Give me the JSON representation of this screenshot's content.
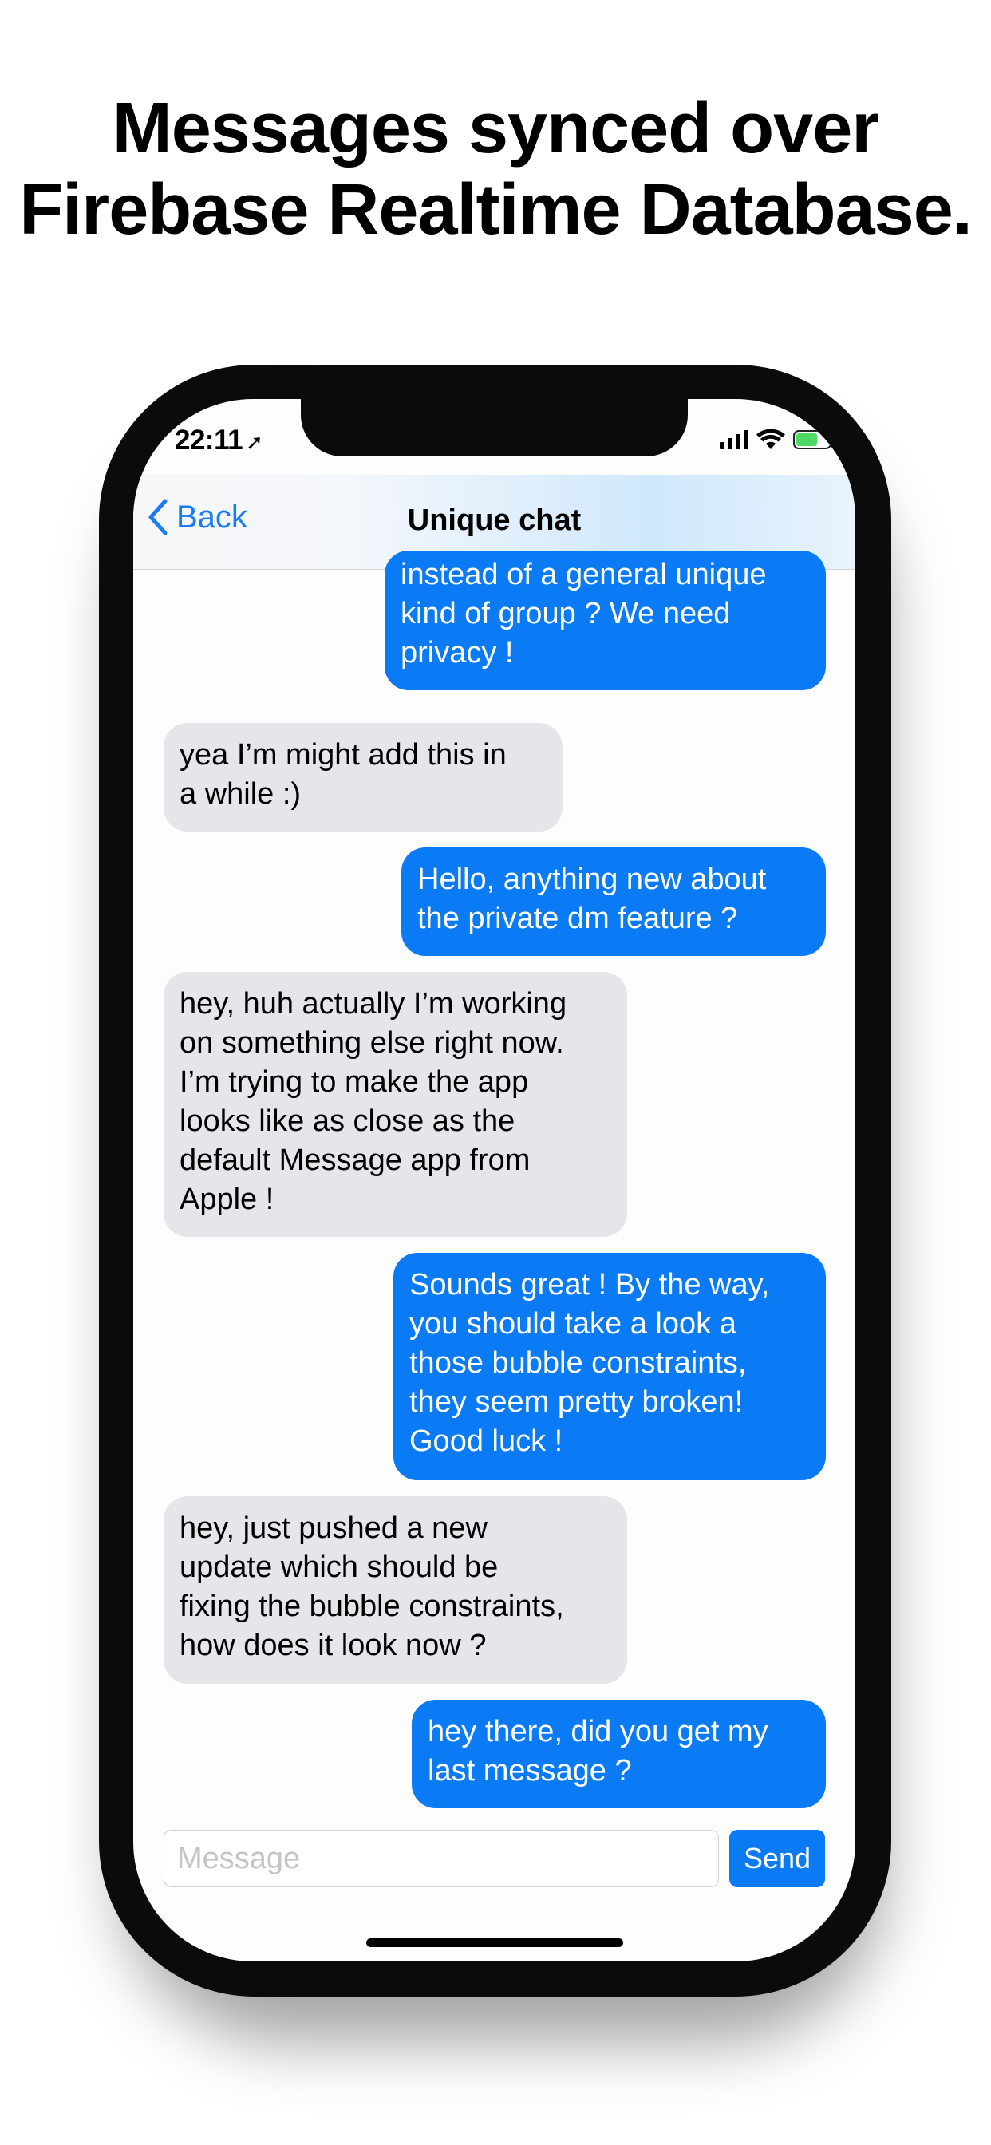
{
  "headline": {
    "line1": "Messages synced over",
    "line2": "Firebase Realtime Database."
  },
  "status_bar": {
    "time": "22:11",
    "icons": [
      "location-arrow-icon",
      "cellular-signal-icon",
      "wifi-icon",
      "battery-charging-icon"
    ]
  },
  "nav": {
    "back_label": "Back",
    "title": "Unique chat"
  },
  "messages": [
    {
      "sender": "me",
      "lines": [
        "instead of a general unique",
        "kind of group ? We need",
        "privacy !"
      ]
    },
    {
      "sender": "them",
      "lines": [
        "yea I’m might add this in",
        "a while :)"
      ]
    },
    {
      "sender": "me",
      "lines": [
        "Hello, anything new about",
        "the private dm feature ?"
      ]
    },
    {
      "sender": "them",
      "lines": [
        "hey, huh actually I’m working",
        "on something else right now.",
        "I’m trying to make the app",
        "looks like as close as the",
        "default Message app from",
        "Apple !"
      ]
    },
    {
      "sender": "me",
      "lines": [
        "Sounds great ! By the way,",
        "you should take a look a",
        "those bubble constraints,",
        "they seem pretty broken!",
        "Good luck !"
      ]
    },
    {
      "sender": "them",
      "lines": [
        "hey, just pushed a new",
        "update which should be",
        "fixing the bubble constraints,",
        "how does it look now ?"
      ]
    },
    {
      "sender": "me",
      "lines": [
        "hey there, did you get my",
        "last message ?"
      ]
    }
  ],
  "composer": {
    "placeholder": "Message",
    "send_label": "Send"
  },
  "colors": {
    "outgoing_bubble": "#0a7bf4",
    "incoming_bubble": "#e5e5ea",
    "accent": "#1a7cf5"
  }
}
